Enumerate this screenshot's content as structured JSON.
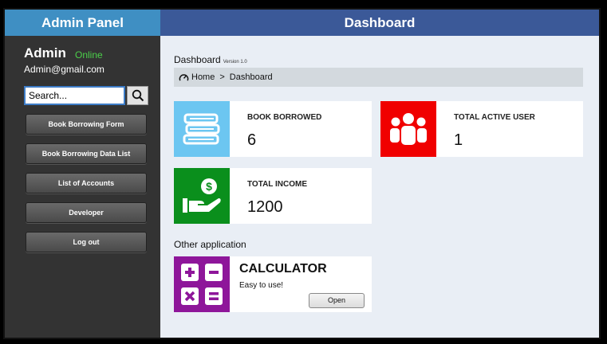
{
  "sidebar": {
    "title": "Admin Panel",
    "user_name": "Admin",
    "status": "Online",
    "email": "Admin@gmail.com",
    "search_placeholder": "Search...",
    "nav": [
      {
        "label": "Book Borrowing Form"
      },
      {
        "label": "Book Borrowing Data List"
      },
      {
        "label": "List of Accounts"
      },
      {
        "label": "Developer"
      },
      {
        "label": "Log out"
      }
    ]
  },
  "header": {
    "title": "Dashboard"
  },
  "main": {
    "title": "Dashboard",
    "version": "Version 1.0",
    "breadcrumb": {
      "home": "Home",
      "separator": ">",
      "current": "Dashboard"
    },
    "cards": [
      {
        "label": "BOOK BORROWED",
        "value": "6",
        "color": "#6cc6f1",
        "icon": "books-icon"
      },
      {
        "label": "TOTAL ACTIVE USER",
        "value": "1",
        "color": "#f00000",
        "icon": "users-icon"
      },
      {
        "label": "TOTAL INCOME",
        "value": "1200",
        "color": "#0a8f1c",
        "icon": "income-icon"
      }
    ],
    "other_apps_heading": "Other application",
    "apps": [
      {
        "title": "CALCULATOR",
        "subtitle": "Easy to use!",
        "button": "Open",
        "color": "#8e169a",
        "icon": "calculator-icon"
      }
    ]
  }
}
